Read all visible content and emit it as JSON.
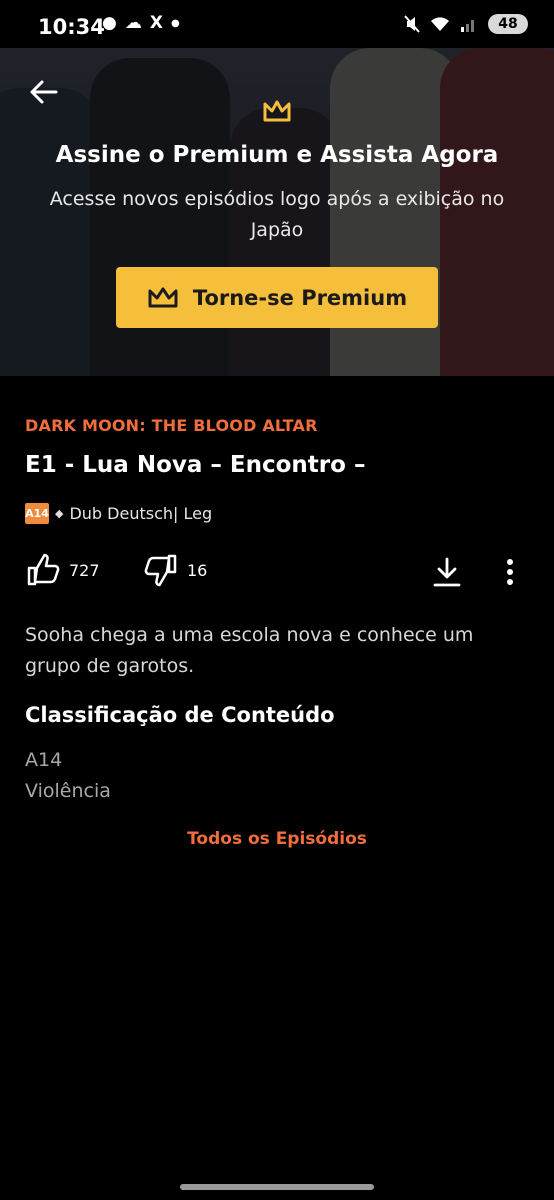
{
  "status_bar": {
    "time": "10:34",
    "left_icons": [
      "chat-bubble-icon",
      "cloud-icon",
      "x-logo-icon",
      "dot-icon"
    ],
    "right_icons": [
      "mute-icon",
      "wifi-icon",
      "signal-icon"
    ],
    "battery": "48"
  },
  "hero": {
    "title": "Assine o Premium e Assista Agora",
    "subtitle": "Acesse novos episódios logo após a exibição no Japão",
    "button_label": "Torne-se Premium",
    "accent_color": "#f5bf3c"
  },
  "episode": {
    "series_title": "DARK MOON: THE BLOOD ALTAR",
    "title": "E1 - Lua Nova – Encontro –",
    "rating_badge": "A14",
    "audio_info": "Dub Deutsch| Leg",
    "likes": "727",
    "dislikes": "16",
    "description": "Sooha chega a uma escola nova e conhece um grupo de garotos."
  },
  "classification": {
    "heading": "Classificação de Conteúdo",
    "items": [
      "A14",
      "Violência"
    ]
  },
  "all_episodes_label": "Todos os Episódios",
  "colors": {
    "orange_accent": "#f06d3c",
    "background": "#000000"
  }
}
